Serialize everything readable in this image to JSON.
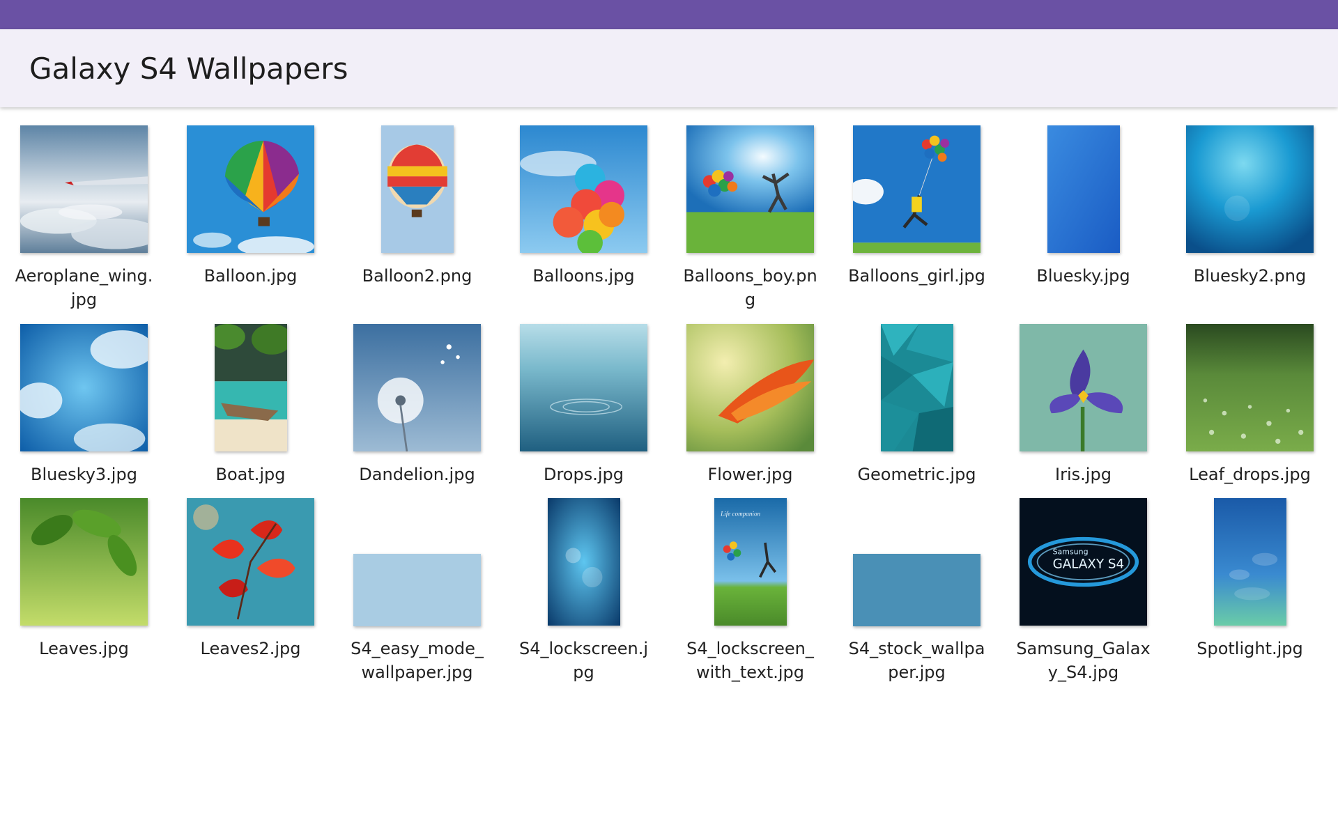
{
  "header": {
    "title": "Galaxy S4 Wallpapers"
  },
  "items": [
    {
      "label": "Aeroplane_wing.jpg"
    },
    {
      "label": "Balloon.jpg"
    },
    {
      "label": "Balloon2.png"
    },
    {
      "label": "Balloons.jpg"
    },
    {
      "label": "Balloons_boy.png"
    },
    {
      "label": "Balloons_girl.jpg"
    },
    {
      "label": "Bluesky.jpg"
    },
    {
      "label": "Bluesky2.png"
    },
    {
      "label": "Bluesky3.jpg"
    },
    {
      "label": "Boat.jpg"
    },
    {
      "label": "Dandelion.jpg"
    },
    {
      "label": "Drops.jpg"
    },
    {
      "label": "Flower.jpg"
    },
    {
      "label": "Geometric.jpg"
    },
    {
      "label": "Iris.jpg"
    },
    {
      "label": "Leaf_drops.jpg"
    },
    {
      "label": "Leaves.jpg"
    },
    {
      "label": "Leaves2.jpg"
    },
    {
      "label": "S4_easy_mode_wallpaper.jpg"
    },
    {
      "label": "S4_lockscreen.jpg"
    },
    {
      "label": "S4_lockscreen_with_text.jpg"
    },
    {
      "label": "S4_stock_wallpaper.jpg"
    },
    {
      "label": "Samsung_Galaxy_S4.jpg"
    },
    {
      "label": "Spotlight.jpg"
    }
  ],
  "thumb_text": {
    "lockscreen_caption": "Life companion",
    "galaxy_brand": "Samsung",
    "galaxy_model": "GALAXY S4"
  }
}
